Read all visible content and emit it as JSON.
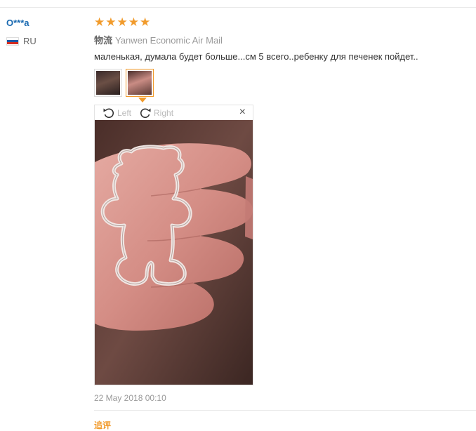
{
  "reviewer": {
    "name": "O***a",
    "country_code": "RU",
    "flag_colors": [
      "#ffffff",
      "#1c57a5",
      "#d52b1e"
    ]
  },
  "review": {
    "rating": 5,
    "star_glyph": "★",
    "shipping_label": "物流",
    "shipping_method": "Yanwen Economic Air Mail",
    "text": "маленькая, думала будет больше...см 5 всего..ребенку для печенек пойдет..",
    "date": "22 May 2018 00:10",
    "followup_label": "追评"
  },
  "gallery": {
    "thumbnails": [
      "photo-thumbnail-1",
      "photo-thumbnail-2"
    ],
    "active_index": 1
  },
  "viewer": {
    "rotate_left_label": "Left",
    "rotate_right_label": "Right",
    "close_glyph": "×"
  },
  "colors": {
    "accent": "#f19b2c",
    "link": "#1a6ab1",
    "muted_text": "#999999"
  }
}
